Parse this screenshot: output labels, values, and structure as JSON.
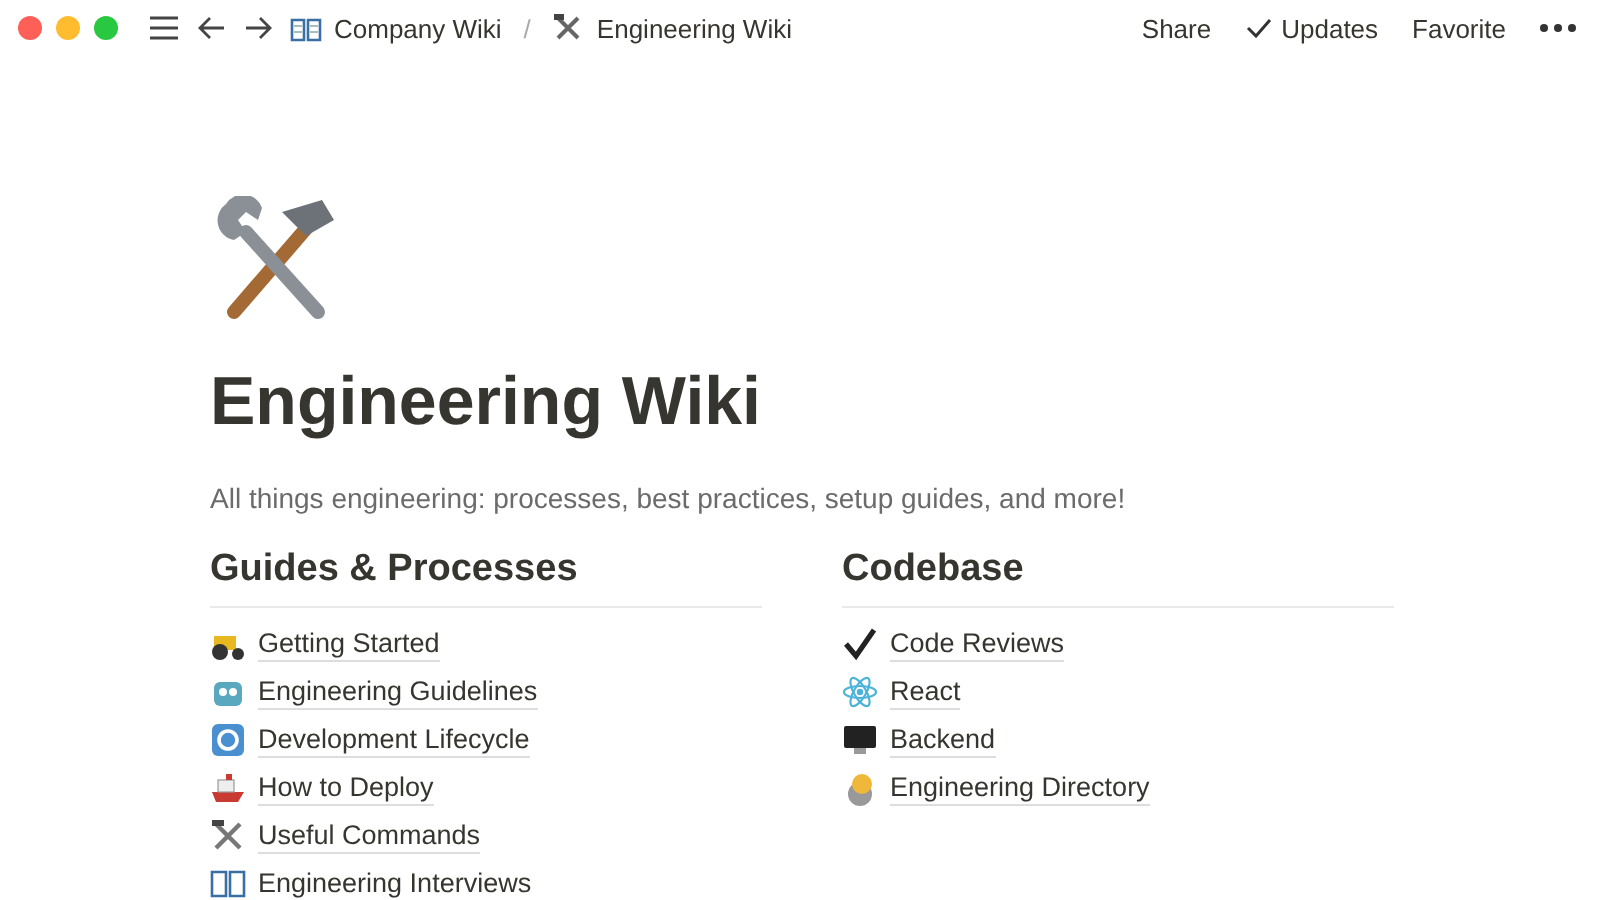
{
  "topbar": {
    "breadcrumbs": [
      {
        "label": "Company Wiki"
      },
      {
        "label": "Engineering Wiki"
      }
    ],
    "separator": "/",
    "actions": [
      {
        "label": "Share",
        "kind": "plain"
      },
      {
        "label": "Updates",
        "kind": "check"
      },
      {
        "label": "Favorite",
        "kind": "plain"
      }
    ]
  },
  "page": {
    "title": "Engineering Wiki",
    "description": "All things engineering: processes, best practices, setup guides, and more!"
  },
  "columns": [
    {
      "heading": "Guides & Processes",
      "links": [
        {
          "label": "Getting Started"
        },
        {
          "label": "Engineering Guidelines"
        },
        {
          "label": "Development Lifecycle"
        },
        {
          "label": "How to Deploy"
        },
        {
          "label": "Useful Commands"
        },
        {
          "label": "Engineering Interviews"
        }
      ]
    },
    {
      "heading": "Codebase",
      "links": [
        {
          "label": "Code Reviews"
        },
        {
          "label": "React"
        },
        {
          "label": "Backend"
        },
        {
          "label": "Engineering Directory"
        }
      ]
    }
  ]
}
